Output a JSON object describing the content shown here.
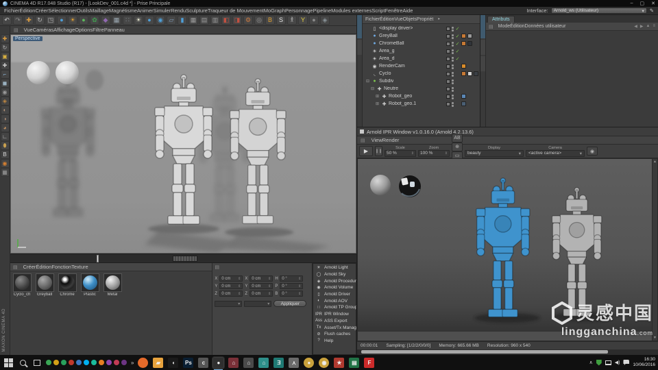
{
  "title_bar": {
    "title": "CINEMA 4D R17.048 Studio (R17) - [LookDev_001.c4d *] - Prise Principale",
    "minimize": "–",
    "maximize": "▢",
    "close": "✕"
  },
  "menu_bar": {
    "items": [
      "Fichier",
      "Édition",
      "Créer",
      "Sélectionner",
      "Outils",
      "Maillage",
      "Magnétisme",
      "Animer",
      "Simuler",
      "Rendu",
      "Sculpture",
      "Traqueur de Mouvement",
      "MoGraph",
      "Personnage",
      "Pipeline",
      "Modules externes",
      "Script",
      "Fenêtre",
      "Aide"
    ],
    "interface_label": "Interface:",
    "interface_value": "Arnold_ws (Utilisateur)",
    "dropdown_glyph": "▾",
    "pencil_glyph": "✎"
  },
  "toolbar": {
    "icons": [
      {
        "n": "undo-icon",
        "g": "↶",
        "c": "#c8c8c8"
      },
      {
        "n": "redo-icon",
        "g": "↷",
        "c": "#8a8a8a"
      },
      {
        "n": "move-tool-icon",
        "g": "✚",
        "c": "#d89a40"
      },
      {
        "n": "rotate-tool-icon",
        "g": "↻",
        "c": "#b8b8b8"
      },
      {
        "n": "scale-tool-icon",
        "g": "◳",
        "c": "#b8b8b8"
      },
      {
        "n": "cube-primitive-icon",
        "g": "●",
        "c": "#4f9fd8"
      },
      {
        "n": "spline-pen-icon",
        "g": "☀",
        "c": "#e0a030"
      },
      {
        "n": "subdivision-surface-icon",
        "g": "●",
        "c": "#5cb85c"
      },
      {
        "n": "clover-deformer-icon",
        "g": "✿",
        "c": "#3f9f4f"
      },
      {
        "n": "mograph-icon",
        "g": "◆",
        "c": "#9068b0"
      },
      {
        "n": "array-icon",
        "g": "▦",
        "c": "#9aa7b0"
      },
      {
        "n": "particles-icon",
        "g": "∷",
        "c": "#8a949a"
      },
      {
        "n": "light-icon",
        "g": "☀",
        "c": "#e8e8d0"
      },
      {
        "n": "sky-icon",
        "g": "●",
        "c": "#4f9fd8"
      },
      {
        "n": "globe-icon",
        "g": "◉",
        "c": "#4f9fd8"
      },
      {
        "n": "floor-plane-icon",
        "g": "▱",
        "c": "#7f9fbf"
      },
      {
        "n": "stage-icon",
        "g": "▮",
        "c": "#4f9fd8"
      },
      {
        "n": "grid-1-icon",
        "g": "▦",
        "c": "#9a9a9a"
      },
      {
        "n": "grid-2-icon",
        "g": "▤",
        "c": "#9a9a9a"
      },
      {
        "n": "grid-3-icon",
        "g": "▥",
        "c": "#9a9a9a"
      },
      {
        "n": "render-view-icon",
        "g": "◧",
        "c": "#c05040"
      },
      {
        "n": "render-region-icon",
        "g": "◨",
        "c": "#c05040"
      },
      {
        "n": "render-settings-icon",
        "g": "⚙",
        "c": "#c87840"
      },
      {
        "n": "texture-view-icon",
        "g": "◎",
        "c": "#9a9a9a"
      },
      {
        "n": "material-b-icon",
        "g": "B",
        "c": "#e0a030"
      },
      {
        "n": "material-s-icon",
        "g": "S",
        "c": "#e8e8e8"
      },
      {
        "n": "character-icon",
        "g": "𐀪",
        "c": "#b8b8b8"
      },
      {
        "n": "slingshot-icon",
        "g": "Y",
        "c": "#e8d040"
      },
      {
        "n": "sphere-gray-icon",
        "g": "●",
        "c": "#8a8a8a"
      },
      {
        "n": "snap-icon",
        "g": "◈",
        "c": "#8a949a"
      }
    ]
  },
  "left_strip": {
    "icons": [
      {
        "n": "move-axis-icon",
        "g": "✚",
        "c": "#d89a40"
      },
      {
        "n": "rotate-icon",
        "g": "↻",
        "c": "#b8b8b8"
      },
      {
        "n": "workplane-icon",
        "g": "▣",
        "c": "#d8b040"
      },
      {
        "n": "add-icon",
        "g": "✚",
        "c": "#c8c8c8"
      },
      {
        "n": "spline-icon",
        "g": "⌐",
        "c": "#8ab0d0"
      },
      {
        "n": "cube-icon",
        "g": "◼",
        "c": "#9ab0c0"
      },
      {
        "n": "subdiv-icon",
        "g": "◉",
        "c": "#9a9a9a"
      },
      {
        "n": "mesh-icon",
        "g": "◈",
        "c": "#c08840"
      },
      {
        "n": "brush-1-icon",
        "g": "◐",
        "c": "#b09078"
      },
      {
        "n": "brush-2-icon",
        "g": "◑",
        "c": "#b09078"
      },
      {
        "n": "brush-3-icon",
        "g": "◕",
        "c": "#c09060"
      },
      {
        "n": "axis-icon",
        "g": "∟",
        "c": "#c8c8c8"
      },
      {
        "n": "mouse-icon",
        "g": "⬮",
        "c": "#c8a050"
      },
      {
        "n": "b-icon",
        "g": "B",
        "c": "#d8d8d8"
      },
      {
        "n": "swirl-icon",
        "g": "◉",
        "c": "#d88030"
      },
      {
        "n": "checker-icon",
        "g": "▦",
        "c": "#9a9a9a"
      }
    ],
    "brand_line1": "MAXON",
    "brand_line2": "CINEMA 4D"
  },
  "viewport": {
    "menu": [
      "Vue",
      "Caméras",
      "Affichage",
      "Options",
      "Filtre",
      "Panneau"
    ],
    "label": "Perspective",
    "grid_glyph": "▤"
  },
  "object_manager": {
    "menu": [
      "Fichier",
      "Édition",
      "Vue",
      "Objets",
      "Propriét"
    ],
    "menu_arrow": "‣",
    "tree": [
      {
        "expand": "",
        "icon": "▯",
        "ic": "#d8d8d8",
        "label": "<display driver>",
        "check": "✓",
        "pad": "2px"
      },
      {
        "expand": "",
        "icon": "●",
        "ic": "#6fa8e0",
        "label": "GreyBall",
        "check": "✓",
        "chip1": "#c77a35",
        "chip2": "#9a9a9a",
        "pad": "2px"
      },
      {
        "expand": "",
        "icon": "●",
        "ic": "#6fa8e0",
        "label": "ChromeBall",
        "check": "✓",
        "chip1": "#c77a35",
        "chip2": "#30343a",
        "pad": "2px"
      },
      {
        "expand": "",
        "icon": "☀",
        "ic": "#e6e6e6",
        "label": "Area_g",
        "check": "✓",
        "pad": "2px"
      },
      {
        "expand": "",
        "icon": "☀",
        "ic": "#e6e6e6",
        "label": "Area_d",
        "check": "✓",
        "pad": "2px"
      },
      {
        "expand": "",
        "icon": "◉",
        "ic": "#cfcfcf",
        "label": "RenderCam",
        "chip1": "#d98c2b",
        "pad": "2px"
      },
      {
        "expand": "",
        "icon": "◟",
        "ic": "#cfcfcf",
        "label": "Cyclo",
        "chip1": "#c77a35",
        "chip2": "#d0d0d0",
        "chip3": "#3a3f45",
        "pad": "2px"
      },
      {
        "expand": "⊟",
        "icon": "●",
        "ic": "#7cc24e",
        "label": "Subdiv",
        "pad": "2px"
      },
      {
        "expand": "⊟",
        "icon": "✚",
        "ic": "#cfcfcf",
        "label": "Neutre",
        "pad": "9px"
      },
      {
        "expand": "⊞",
        "icon": "✚",
        "ic": "#cfcfcf",
        "label": "Robot_geo",
        "chip1": "#5b87b5",
        "pad": "16px"
      },
      {
        "expand": "⊞",
        "icon": "✚",
        "ic": "#cfcfcf",
        "label": "Robot_geo.1",
        "chip1": "#4a5f74",
        "pad": "16px"
      }
    ]
  },
  "attributes": {
    "tab": "Attributs",
    "menu": [
      "Mode",
      "Édition",
      "Données utilisateur"
    ],
    "nav_icons": [
      "◀",
      "▶",
      "▲",
      "≡"
    ]
  },
  "ipr": {
    "title": "Arnold IPR Window v1.0.16.0 (Arnold 4.2.13.6)",
    "menus": [
      "View",
      "Render"
    ],
    "play": "▶",
    "pause": "❙❙",
    "scale_label": "Scale",
    "scale_value": "50 %",
    "zoom_label": "Zoom",
    "zoom_value": "100 %",
    "stepper": "⇕",
    "tool_icons": [
      {
        "n": "ab-compare-icon",
        "g": "AB"
      },
      {
        "n": "crosshair-icon",
        "g": "⊕"
      },
      {
        "n": "region-icon",
        "g": "▭"
      },
      {
        "n": "refresh-icon",
        "g": "↻"
      }
    ],
    "display_label": "Display",
    "display_value": "beauty",
    "camera_label": "Camera",
    "camera_value": "<active camera>",
    "dropdown_glyph": "▾",
    "snapshot_glyph": "◉",
    "status": {
      "time": "00:00:01",
      "sampling": "Sampling: [1/2/2/0/0/0]",
      "memory": "Memory: 665.66 MB",
      "resolution": "Resolution: 960 x 540"
    },
    "scroll_up": "▲",
    "scroll_down": "▼"
  },
  "materials": {
    "menu": [
      "Créer",
      "Édition",
      "Fonction",
      "Texture"
    ],
    "grid_glyph": "▤",
    "items": [
      {
        "name": "Cyclo_ch",
        "kind": "dark"
      },
      {
        "name": "Greyball",
        "kind": "grey"
      },
      {
        "name": "Chrome",
        "kind": "chrome"
      },
      {
        "name": "Plastic",
        "kind": "blue"
      },
      {
        "name": "Metal",
        "kind": "metal"
      }
    ]
  },
  "coordinates": {
    "grid_glyph": "▤",
    "position": [
      {
        "l": "X",
        "v": "0 cm"
      },
      {
        "l": "Y",
        "v": "0 cm"
      },
      {
        "l": "Z",
        "v": "0 cm"
      }
    ],
    "size": [
      {
        "l": "X",
        "v": "0 cm"
      },
      {
        "l": "Y",
        "v": "0 cm"
      },
      {
        "l": "Z",
        "v": "0 cm"
      }
    ],
    "rotation": [
      {
        "l": "H",
        "v": "0 °"
      },
      {
        "l": "P",
        "v": "0 °"
      },
      {
        "l": "B",
        "v": "0 °"
      }
    ],
    "stepper": "⇕",
    "dropdown_glyph": "▾",
    "apply_label": "Appliquer"
  },
  "arnold_menu": {
    "items": [
      {
        "g": "☀",
        "label": "Arnold Light"
      },
      {
        "g": "◯",
        "label": "Arnold Sky"
      },
      {
        "g": "◈",
        "label": "Arnold Procedural"
      },
      {
        "g": "◉",
        "label": "Arnold Volume"
      },
      {
        "g": "▯",
        "label": "Arnold Driver"
      },
      {
        "g": "◐",
        "label": "Arnold AOV"
      },
      {
        "g": "∷",
        "label": "Arnold TP Group"
      },
      {
        "g": "IPR",
        "label": "IPR Window"
      },
      {
        "g": "Ass",
        "label": "ASS Export"
      },
      {
        "g": "Tx",
        "label": "Asset/Tx Manager"
      },
      {
        "g": "⊘",
        "label": "Flush caches"
      },
      {
        "g": "?",
        "label": "Help"
      }
    ]
  },
  "watermark": {
    "cn": "灵感中国",
    "en": "lingganchina",
    "com": ".com"
  },
  "taskbar": {
    "overflow": "»",
    "caret": "∧",
    "tray_dots": [
      "#3aa655",
      "#d4a017",
      "#28a05c",
      "#c0392b",
      "#3b78c3",
      "#00aff0",
      "#1abc9c",
      "#e67e22",
      "#8e44ad",
      "#c23b55",
      "#6c3483"
    ],
    "apps": [
      {
        "n": "firefox-icon",
        "g": "",
        "bg": "#e66a2a",
        "round": "round"
      },
      {
        "n": "folder-icon",
        "g": "▰",
        "bg": "#e8a33d"
      },
      {
        "n": "media-app-icon",
        "g": "◖",
        "bg": "#1a1a1a"
      },
      {
        "n": "photoshop-icon",
        "g": "Ps",
        "bg": "#0a1f33"
      },
      {
        "n": "sync-app-icon",
        "g": "c",
        "bg": "#555555"
      },
      {
        "n": "cinema4d-active-icon",
        "g": "●",
        "bg": "#2f2f2f",
        "round": "active"
      },
      {
        "n": "creative-app-1-icon",
        "g": "⌂",
        "bg": "#7a3038"
      },
      {
        "n": "creative-app-2-icon",
        "g": "⌂",
        "bg": "#4a4a4a"
      },
      {
        "n": "creative-app-3-icon",
        "g": "⌂",
        "bg": "#2e8f8a"
      },
      {
        "n": "swirl-app-icon",
        "g": "Ǝ",
        "bg": "#1f7a74"
      },
      {
        "n": "figure-app-icon",
        "g": "⋏",
        "bg": "#6a6a6a"
      },
      {
        "n": "gold-app-1-icon",
        "g": "●",
        "bg": "#caa23c",
        "round": "round"
      },
      {
        "n": "gold-app-2-icon",
        "g": "◉",
        "bg": "#caa23c",
        "round": "round"
      },
      {
        "n": "red-star-app-icon",
        "g": "★",
        "bg": "#b03a30"
      },
      {
        "n": "excel-icon",
        "g": "▤",
        "bg": "#217346"
      },
      {
        "n": "flipboard-icon",
        "g": "F",
        "bg": "#cc2a2a"
      }
    ],
    "clock_time": "16:30",
    "clock_date": "10/06/2016"
  }
}
